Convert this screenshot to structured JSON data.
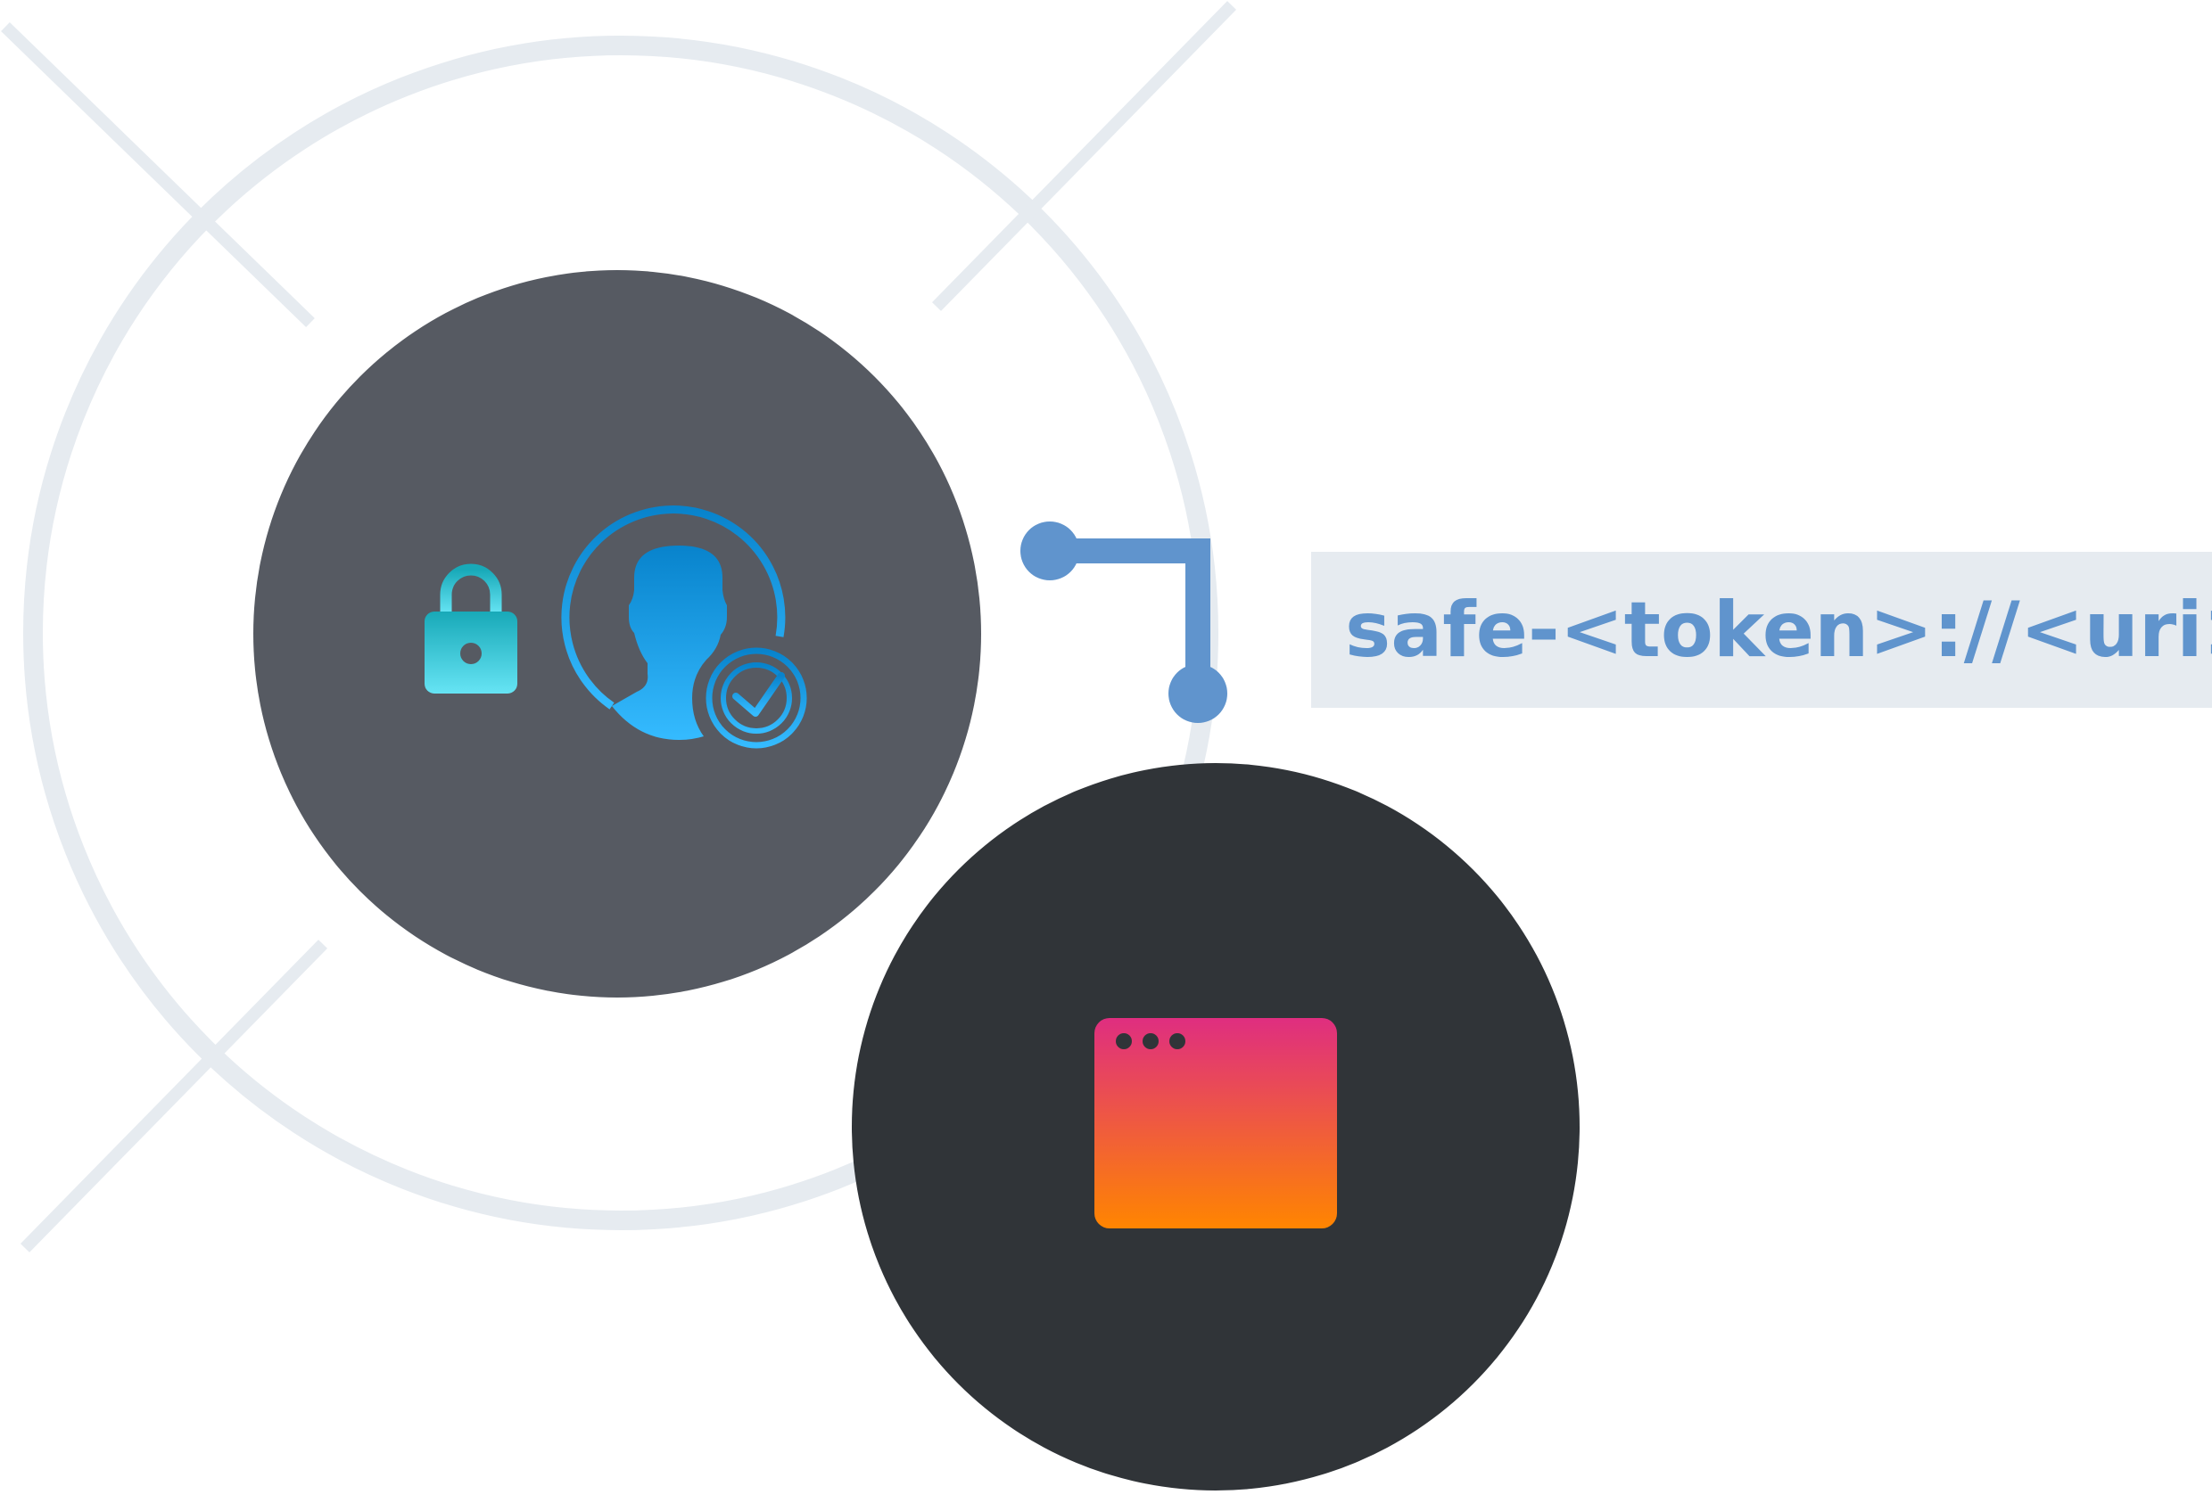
{
  "diagram": {
    "uri_label": "safe-<token>://<uri>",
    "icons": {
      "lock": "lock-icon",
      "user_verified": "user-check-icon",
      "app_window": "app-window-icon"
    },
    "colors": {
      "background": "#ffffff",
      "decor_lines": "#e6ebf0",
      "auth_circle": "#565a62",
      "app_circle": "#303438",
      "connector": "#6094cd",
      "uri_text": "#6094cd",
      "uri_box": "#e6ebf0",
      "lock_gradient_top": "#18a9b8",
      "lock_gradient_bottom": "#66e4f4",
      "user_gradient_top": "#0883cc",
      "user_gradient_bottom": "#35bbff",
      "window_gradient_top": "#df2e80",
      "window_gradient_bottom": "#ff8500",
      "window_dots": "#303438"
    }
  }
}
